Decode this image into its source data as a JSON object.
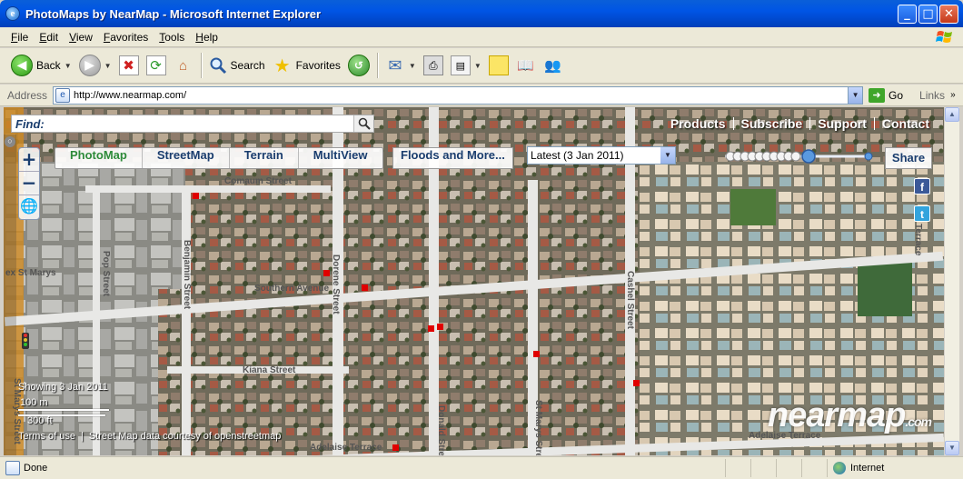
{
  "window": {
    "title": "PhotoMaps by NearMap - Microsoft Internet Explorer"
  },
  "menu": [
    "File",
    "Edit",
    "View",
    "Favorites",
    "Tools",
    "Help"
  ],
  "toolbar": {
    "back": "Back",
    "search": "Search",
    "favorites": "Favorites"
  },
  "address": {
    "label": "Address",
    "url": "http://www.nearmap.com/",
    "go": "Go",
    "links": "Links"
  },
  "page": {
    "find_label": "Find:",
    "top_links": [
      "Products",
      "Subscribe",
      "Support",
      "Contact"
    ],
    "map_tabs": [
      "PhotoMap",
      "StreetMap",
      "Terrain",
      "MultiView"
    ],
    "floods": "Floods and More...",
    "date_selected": "Latest (3 Jan 2011)",
    "share": "Share",
    "social": {
      "facebook": "f",
      "twitter": "t"
    },
    "showing": "Showing 3 Jan 2011",
    "scale_metric": "100 m",
    "scale_imperial": "300 ft",
    "footer": [
      "Terms of use",
      "|",
      "Street Map data courtesy of openstreetmap"
    ],
    "brand": "nearmap",
    "brand_suffix": ".com",
    "streets": {
      "comaum": "Comaum Street",
      "southern": "Southern Avenue",
      "kiana": "Kiana Street",
      "adelaise_left": "Adelaise Terrace",
      "adelaise_right": "Adelaise Terrace",
      "benjamin": "Benjamin Street",
      "pop": "Pop Street",
      "dorene": "Dorene Street",
      "donald": "Donald Street",
      "st_marys": "St Marys Street",
      "cashel": "Cashel Street",
      "right_terrace": "Terrace",
      "left_st_marys": "ex St Marys",
      "left_vertical": "St Marys Street"
    }
  },
  "status": {
    "text": "Done",
    "zone": "Internet"
  },
  "colors": {
    "map_green": "#2e8b3a",
    "map_blue": "#1a3d6e",
    "marker": "#e00000"
  }
}
